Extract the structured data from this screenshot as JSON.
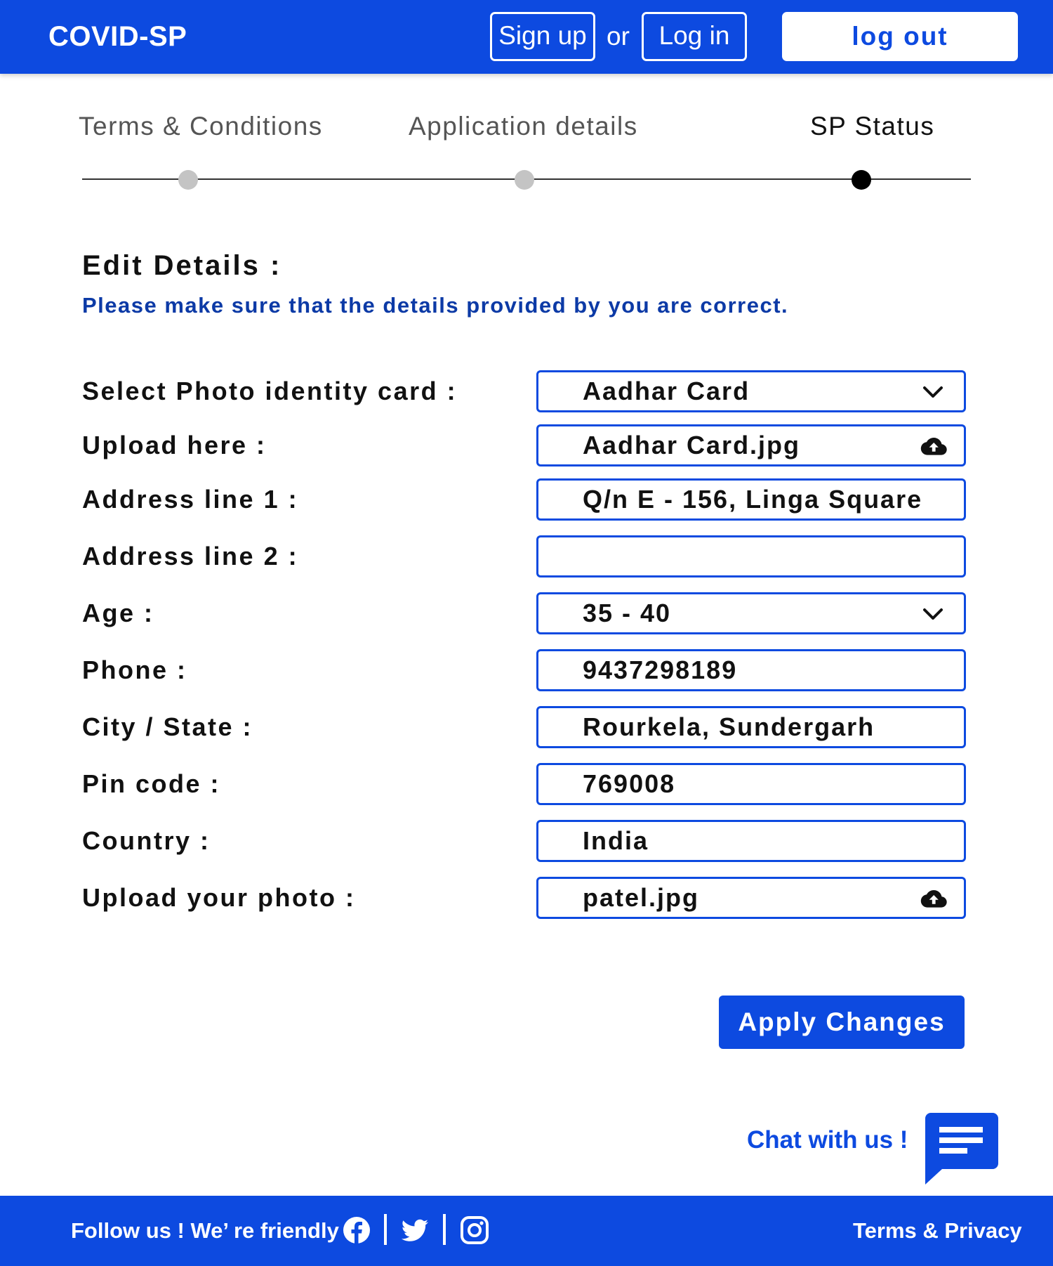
{
  "header": {
    "logo": "COVID-SP",
    "signup_label": "Sign up",
    "or_text": "or",
    "login_label": "Log in",
    "logout_label": "log out"
  },
  "stepper": {
    "steps": [
      {
        "label": "Terms & Conditions",
        "state": "done"
      },
      {
        "label": "Application details",
        "state": "done"
      },
      {
        "label": "SP Status",
        "state": "active"
      }
    ]
  },
  "section": {
    "title": "Edit Details :",
    "note": "Please make sure that the details provided by you are correct."
  },
  "form": {
    "fields": [
      {
        "label": "Select Photo identity card :",
        "value": "Aadhar Card",
        "type": "select",
        "icon": "chevron-down-icon"
      },
      {
        "label": "Upload here :",
        "value": "Aadhar Card.jpg",
        "type": "upload",
        "icon": "cloud-upload-icon"
      },
      {
        "label": "Address line 1 :",
        "value": "Q/n E - 156, Linga Square",
        "type": "text"
      },
      {
        "label": "Address line 2 :",
        "value": "",
        "type": "text"
      },
      {
        "label": "Age :",
        "value": "35 - 40",
        "type": "select",
        "icon": "chevron-down-icon"
      },
      {
        "label": "Phone :",
        "value": "9437298189",
        "type": "text"
      },
      {
        "label": "City / State :",
        "value": "Rourkela, Sundergarh",
        "type": "text"
      },
      {
        "label": "Pin code :",
        "value": "769008",
        "type": "text"
      },
      {
        "label": "Country :",
        "value": "India",
        "type": "text"
      },
      {
        "label": "Upload your photo :",
        "value": "patel.jpg",
        "type": "upload",
        "icon": "cloud-upload-icon"
      }
    ],
    "apply_label": "Apply Changes"
  },
  "chat": {
    "label": "Chat with us !",
    "icon": "chat-bubble-icon"
  },
  "footer": {
    "follow_text": "Follow us !  We’ re friendly :",
    "social_icons": [
      "facebook-icon",
      "twitter-icon",
      "instagram-icon"
    ],
    "terms_label": "Terms & Privacy"
  },
  "colors": {
    "brand_blue": "#0d4ae0",
    "note_blue": "#0c3aa6",
    "step_inactive": "#c4c4c4",
    "step_active": "#000000"
  }
}
